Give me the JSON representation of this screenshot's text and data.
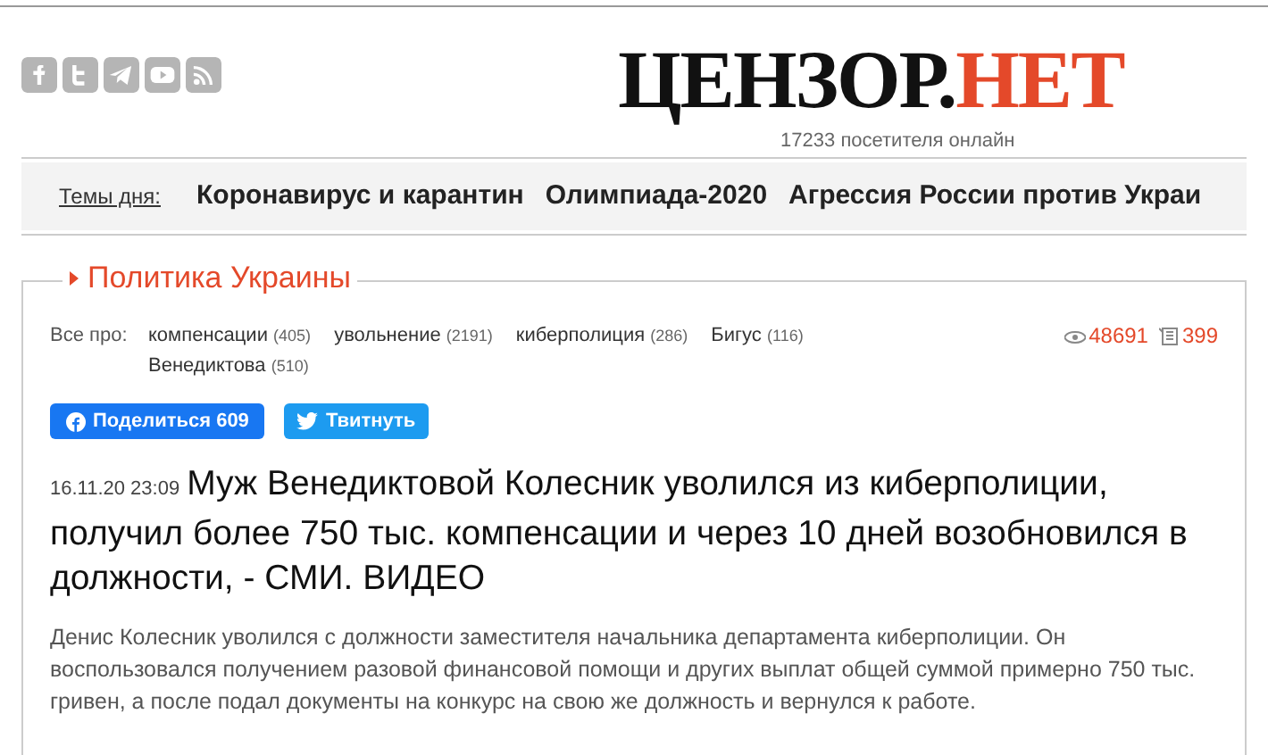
{
  "header": {
    "social": [
      {
        "kind": "facebook"
      },
      {
        "kind": "twitter"
      },
      {
        "kind": "telegram"
      },
      {
        "kind": "youtube"
      },
      {
        "kind": "rss"
      }
    ],
    "logo": {
      "dark": "ЦЕНЗОР.",
      "accent": "НЕТ"
    },
    "visitors": "17233 посетителя онлайн"
  },
  "topics": {
    "label": "Темы дня:",
    "items": [
      "Коронавирус и карантин",
      "Олимпиада-2020",
      "Агрессия России против Украи"
    ]
  },
  "article": {
    "section": "Политика Украины",
    "tags_label": "Все про:",
    "tags": [
      {
        "name": "компенсации",
        "count": "(405)"
      },
      {
        "name": "увольнение",
        "count": "(2191)"
      },
      {
        "name": "киберполиция",
        "count": "(286)"
      },
      {
        "name": "Бигус",
        "count": "(116)"
      },
      {
        "name": "Венедиктова",
        "count": "(510)"
      }
    ],
    "views": "48691",
    "comments": "399",
    "share": {
      "facebook": "Поделиться 609",
      "twitter": "Твитнуть"
    },
    "date": "16.11.20 23:09",
    "title": "Муж Венедиктовой Колесник уволился из киберполиции, получил более 750 тыс. компенсации и через 10 дней возобновился в должности, - СМИ. ВИДЕО",
    "lead": "Денис Колесник уволился с должности заместителя начальника департамента киберполиции. Он воспользовался получением разовой финансовой помощи и других выплат общей суммой примерно 750 тыс. гривен, а после подал документы на конкурс на свою же должность и вернулся к работе."
  }
}
